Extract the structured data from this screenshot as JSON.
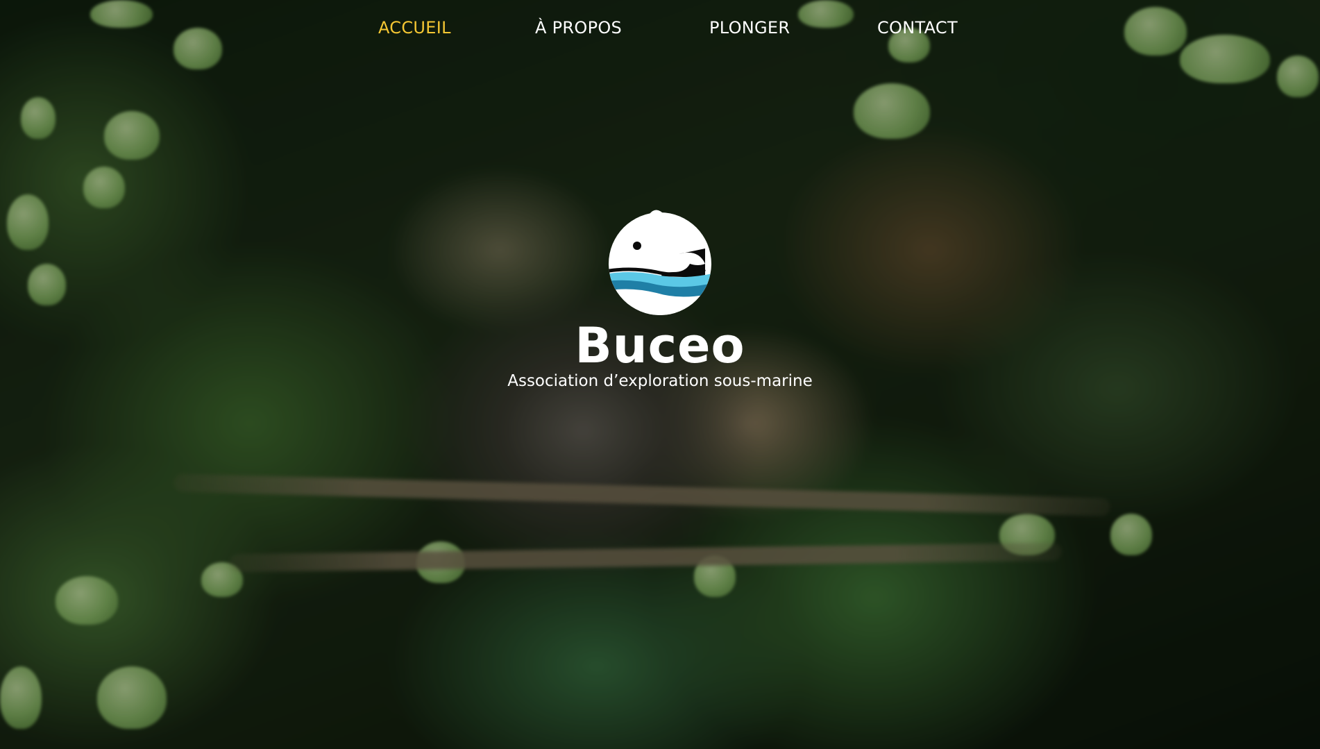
{
  "nav": {
    "items": [
      {
        "label": "ACCUEIL",
        "active": true
      },
      {
        "label": "À PROPOS",
        "active": false
      },
      {
        "label": "PLONGER",
        "active": false
      },
      {
        "label": "CONTACT",
        "active": false
      }
    ],
    "active_color": "#f5c733",
    "default_color": "#ffffff"
  },
  "hero": {
    "brand": "Buceo",
    "tagline": "Association d’exploration sous-marine",
    "logo_icon": "fish-in-water-logo-icon",
    "logo_colors": {
      "circle": "#ffffff",
      "fish": "#ffffff",
      "water_light": "#5bc8e6",
      "water_dark": "#1f7fa6",
      "outline": "#000000"
    }
  },
  "background": {
    "description_icon": "forest-canopy-background"
  }
}
